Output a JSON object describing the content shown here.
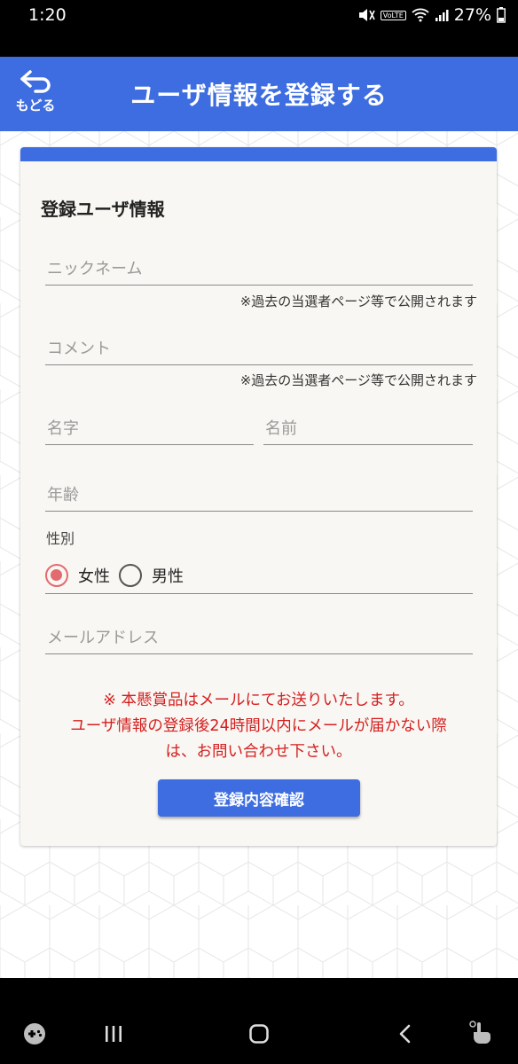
{
  "status_bar": {
    "time": "1:20",
    "battery": "27%",
    "volte_label": "VoLTE"
  },
  "header": {
    "back_label": "もどる",
    "title": "ユーザ情報を登録する"
  },
  "form": {
    "section_title": "登録ユーザ情報",
    "nickname_placeholder": "ニックネーム",
    "nickname_note": "※過去の当選者ページ等で公開されます",
    "comment_placeholder": "コメント",
    "comment_note": "※過去の当選者ページ等で公開されます",
    "lastname_placeholder": "名字",
    "firstname_placeholder": "名前",
    "age_placeholder": "年齢",
    "gender_label": "性別",
    "gender_options": [
      {
        "label": "女性",
        "selected": true
      },
      {
        "label": "男性",
        "selected": false
      }
    ],
    "email_placeholder": "メールアドレス",
    "notice_lines": [
      "※ 本懸賞品はメールにてお送りいたします。",
      "ユーザ情報の登録後24時間以内にメールが届かない際",
      "は、お問い合わせ下さい。"
    ],
    "confirm_button": "登録内容確認"
  },
  "colors": {
    "accent": "#3d6de0",
    "radio_selected": "#e36a6f",
    "notice": "#d42020"
  },
  "nav_bar": {
    "icons": [
      "game-launcher-icon",
      "recent-apps-icon",
      "home-icon",
      "back-icon",
      "touch-icon"
    ]
  }
}
